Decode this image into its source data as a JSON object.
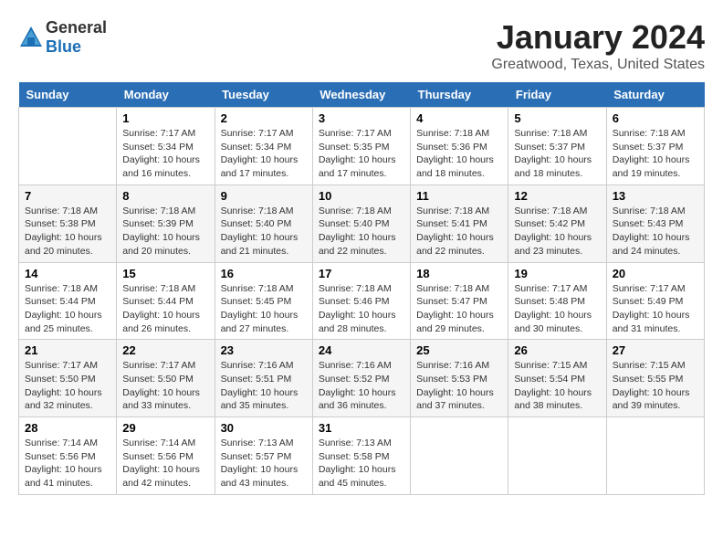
{
  "header": {
    "logo_general": "General",
    "logo_blue": "Blue",
    "month_title": "January 2024",
    "location": "Greatwood, Texas, United States"
  },
  "weekdays": [
    "Sunday",
    "Monday",
    "Tuesday",
    "Wednesday",
    "Thursday",
    "Friday",
    "Saturday"
  ],
  "weeks": [
    [
      {
        "day": "",
        "sunrise": "",
        "sunset": "",
        "daylight": ""
      },
      {
        "day": "1",
        "sunrise": "Sunrise: 7:17 AM",
        "sunset": "Sunset: 5:34 PM",
        "daylight": "Daylight: 10 hours and 16 minutes."
      },
      {
        "day": "2",
        "sunrise": "Sunrise: 7:17 AM",
        "sunset": "Sunset: 5:34 PM",
        "daylight": "Daylight: 10 hours and 17 minutes."
      },
      {
        "day": "3",
        "sunrise": "Sunrise: 7:17 AM",
        "sunset": "Sunset: 5:35 PM",
        "daylight": "Daylight: 10 hours and 17 minutes."
      },
      {
        "day": "4",
        "sunrise": "Sunrise: 7:18 AM",
        "sunset": "Sunset: 5:36 PM",
        "daylight": "Daylight: 10 hours and 18 minutes."
      },
      {
        "day": "5",
        "sunrise": "Sunrise: 7:18 AM",
        "sunset": "Sunset: 5:37 PM",
        "daylight": "Daylight: 10 hours and 18 minutes."
      },
      {
        "day": "6",
        "sunrise": "Sunrise: 7:18 AM",
        "sunset": "Sunset: 5:37 PM",
        "daylight": "Daylight: 10 hours and 19 minutes."
      }
    ],
    [
      {
        "day": "7",
        "sunrise": "Sunrise: 7:18 AM",
        "sunset": "Sunset: 5:38 PM",
        "daylight": "Daylight: 10 hours and 20 minutes."
      },
      {
        "day": "8",
        "sunrise": "Sunrise: 7:18 AM",
        "sunset": "Sunset: 5:39 PM",
        "daylight": "Daylight: 10 hours and 20 minutes."
      },
      {
        "day": "9",
        "sunrise": "Sunrise: 7:18 AM",
        "sunset": "Sunset: 5:40 PM",
        "daylight": "Daylight: 10 hours and 21 minutes."
      },
      {
        "day": "10",
        "sunrise": "Sunrise: 7:18 AM",
        "sunset": "Sunset: 5:40 PM",
        "daylight": "Daylight: 10 hours and 22 minutes."
      },
      {
        "day": "11",
        "sunrise": "Sunrise: 7:18 AM",
        "sunset": "Sunset: 5:41 PM",
        "daylight": "Daylight: 10 hours and 22 minutes."
      },
      {
        "day": "12",
        "sunrise": "Sunrise: 7:18 AM",
        "sunset": "Sunset: 5:42 PM",
        "daylight": "Daylight: 10 hours and 23 minutes."
      },
      {
        "day": "13",
        "sunrise": "Sunrise: 7:18 AM",
        "sunset": "Sunset: 5:43 PM",
        "daylight": "Daylight: 10 hours and 24 minutes."
      }
    ],
    [
      {
        "day": "14",
        "sunrise": "Sunrise: 7:18 AM",
        "sunset": "Sunset: 5:44 PM",
        "daylight": "Daylight: 10 hours and 25 minutes."
      },
      {
        "day": "15",
        "sunrise": "Sunrise: 7:18 AM",
        "sunset": "Sunset: 5:44 PM",
        "daylight": "Daylight: 10 hours and 26 minutes."
      },
      {
        "day": "16",
        "sunrise": "Sunrise: 7:18 AM",
        "sunset": "Sunset: 5:45 PM",
        "daylight": "Daylight: 10 hours and 27 minutes."
      },
      {
        "day": "17",
        "sunrise": "Sunrise: 7:18 AM",
        "sunset": "Sunset: 5:46 PM",
        "daylight": "Daylight: 10 hours and 28 minutes."
      },
      {
        "day": "18",
        "sunrise": "Sunrise: 7:18 AM",
        "sunset": "Sunset: 5:47 PM",
        "daylight": "Daylight: 10 hours and 29 minutes."
      },
      {
        "day": "19",
        "sunrise": "Sunrise: 7:17 AM",
        "sunset": "Sunset: 5:48 PM",
        "daylight": "Daylight: 10 hours and 30 minutes."
      },
      {
        "day": "20",
        "sunrise": "Sunrise: 7:17 AM",
        "sunset": "Sunset: 5:49 PM",
        "daylight": "Daylight: 10 hours and 31 minutes."
      }
    ],
    [
      {
        "day": "21",
        "sunrise": "Sunrise: 7:17 AM",
        "sunset": "Sunset: 5:50 PM",
        "daylight": "Daylight: 10 hours and 32 minutes."
      },
      {
        "day": "22",
        "sunrise": "Sunrise: 7:17 AM",
        "sunset": "Sunset: 5:50 PM",
        "daylight": "Daylight: 10 hours and 33 minutes."
      },
      {
        "day": "23",
        "sunrise": "Sunrise: 7:16 AM",
        "sunset": "Sunset: 5:51 PM",
        "daylight": "Daylight: 10 hours and 35 minutes."
      },
      {
        "day": "24",
        "sunrise": "Sunrise: 7:16 AM",
        "sunset": "Sunset: 5:52 PM",
        "daylight": "Daylight: 10 hours and 36 minutes."
      },
      {
        "day": "25",
        "sunrise": "Sunrise: 7:16 AM",
        "sunset": "Sunset: 5:53 PM",
        "daylight": "Daylight: 10 hours and 37 minutes."
      },
      {
        "day": "26",
        "sunrise": "Sunrise: 7:15 AM",
        "sunset": "Sunset: 5:54 PM",
        "daylight": "Daylight: 10 hours and 38 minutes."
      },
      {
        "day": "27",
        "sunrise": "Sunrise: 7:15 AM",
        "sunset": "Sunset: 5:55 PM",
        "daylight": "Daylight: 10 hours and 39 minutes."
      }
    ],
    [
      {
        "day": "28",
        "sunrise": "Sunrise: 7:14 AM",
        "sunset": "Sunset: 5:56 PM",
        "daylight": "Daylight: 10 hours and 41 minutes."
      },
      {
        "day": "29",
        "sunrise": "Sunrise: 7:14 AM",
        "sunset": "Sunset: 5:56 PM",
        "daylight": "Daylight: 10 hours and 42 minutes."
      },
      {
        "day": "30",
        "sunrise": "Sunrise: 7:13 AM",
        "sunset": "Sunset: 5:57 PM",
        "daylight": "Daylight: 10 hours and 43 minutes."
      },
      {
        "day": "31",
        "sunrise": "Sunrise: 7:13 AM",
        "sunset": "Sunset: 5:58 PM",
        "daylight": "Daylight: 10 hours and 45 minutes."
      },
      {
        "day": "",
        "sunrise": "",
        "sunset": "",
        "daylight": ""
      },
      {
        "day": "",
        "sunrise": "",
        "sunset": "",
        "daylight": ""
      },
      {
        "day": "",
        "sunrise": "",
        "sunset": "",
        "daylight": ""
      }
    ]
  ]
}
